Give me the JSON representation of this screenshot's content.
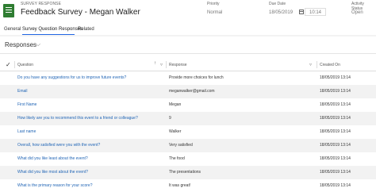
{
  "record": {
    "type_label": "SURVEY RESPONSE",
    "title": "Feedback Survey - Megan Walker"
  },
  "header_fields": {
    "priority": {
      "label": "Priority",
      "value": "Normal"
    },
    "due_date": {
      "label": "Due Date",
      "date": "18/05/2019",
      "time": "10:14"
    },
    "activity_status": {
      "label": "Activity Status",
      "value": "Open"
    }
  },
  "tabs": [
    {
      "label": "General"
    },
    {
      "label": "Survey Question Responses"
    },
    {
      "label": "Related"
    }
  ],
  "section": {
    "title": "Responses",
    "chevron": "⌵"
  },
  "table": {
    "columns": {
      "question": "Question",
      "response": "Response",
      "created_on": "Created On"
    },
    "rows": [
      {
        "question": "Do you have any suggestions for us to improve future events?",
        "response": "Provide more choices for lunch",
        "created_on": "18/05/2019 13:14"
      },
      {
        "question": "Email",
        "response": "meganwalker@gmail.com",
        "created_on": "18/05/2019 13:14"
      },
      {
        "question": "First Name",
        "response": "Megan",
        "created_on": "18/05/2019 13:14"
      },
      {
        "question": "How likely are you to recommend this event to a friend or colleague?",
        "response": "9",
        "created_on": "18/05/2019 13:14"
      },
      {
        "question": "Last name",
        "response": "Walker",
        "created_on": "18/05/2019 13:14"
      },
      {
        "question": "Overall, how satisfied were you with the event?",
        "response": "Very satisfied",
        "created_on": "18/05/2019 13:14"
      },
      {
        "question": "What did you like least about the event?",
        "response": "The food",
        "created_on": "18/05/2019 13:14"
      },
      {
        "question": "What did you like most about the event?",
        "response": "The presentations",
        "created_on": "18/05/2019 13:14"
      },
      {
        "question": "What is the primary reason for your score?",
        "response": "It was great!",
        "created_on": "18/05/2019 13:14"
      }
    ]
  },
  "colors": {
    "link": "#2266b6",
    "accent": "#2266e3",
    "record_icon": "#2f7d32"
  },
  "icons": [
    "survey-record-icon",
    "calendar-icon",
    "chevron-down-icon",
    "checkmark-icon",
    "sort-ascending-icon",
    "filter-chevron-icon"
  ]
}
